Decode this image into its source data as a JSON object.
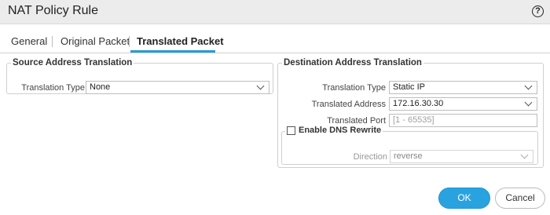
{
  "dialog": {
    "title": "NAT Policy Rule"
  },
  "tabs": [
    {
      "label": "General"
    },
    {
      "label": "Original Packet"
    },
    {
      "label": "Translated Packet"
    }
  ],
  "source": {
    "legend": "Source Address Translation",
    "type_label": "Translation Type",
    "type_value": "None"
  },
  "destination": {
    "legend": "Destination Address Translation",
    "type_label": "Translation Type",
    "type_value": "Static IP",
    "address_label": "Translated Address",
    "address_value": "172.16.30.30",
    "port_label": "Translated Port",
    "port_placeholder": "[1 - 65535]",
    "dns_label": "Enable DNS Rewrite",
    "direction_label": "Direction",
    "direction_value": "reverse"
  },
  "buttons": {
    "ok": "OK",
    "cancel": "Cancel"
  }
}
